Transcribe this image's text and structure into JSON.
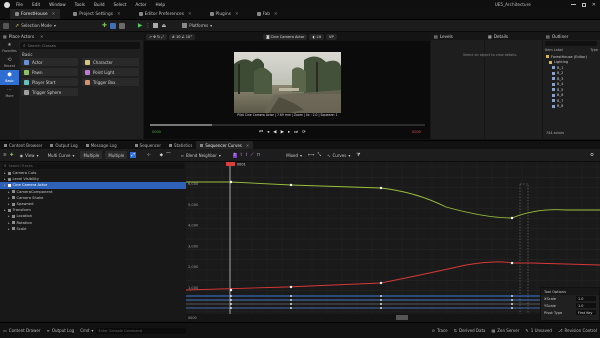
{
  "menu": [
    "File",
    "Edit",
    "Window",
    "Tools",
    "Build",
    "Select",
    "Actor",
    "Help"
  ],
  "project_name": "UE5_Architecture",
  "doc_tabs": [
    {
      "label": "ForestHouse",
      "active": true
    },
    {
      "label": "Project Settings",
      "active": false
    },
    {
      "label": "Editor Preferences",
      "active": false
    },
    {
      "label": "Plugins",
      "active": false
    },
    {
      "label": "Fab",
      "active": false
    }
  ],
  "toolbar": {
    "selection_mode": "Selection Mode",
    "platforms": "Platforms"
  },
  "place_actors": {
    "title": "Place Actors",
    "search_placeholder": "Search Classes",
    "section": "Basic",
    "categories": [
      "Favorites",
      "Recent",
      "Basic",
      "More"
    ],
    "items": [
      [
        "Actor",
        "Character"
      ],
      [
        "Pawn",
        "Point Light"
      ],
      [
        "Player Start",
        "Trigger Box"
      ],
      [
        "Trigger Sphere",
        ""
      ]
    ]
  },
  "viewport": {
    "camera_label": "Cine Camera Actor",
    "lit_label": "Lit",
    "view_label": "VP",
    "caption": "Pilot Cine Camera Actor | 7.69 mm | Zoom | 4x : 2.0 | Squeeze: 1",
    "frame_start": "0000",
    "frame_end": "0000"
  },
  "levels": {
    "title": "Levels",
    "hint": "Select an object to view details."
  },
  "details": {
    "title": "Details"
  },
  "outliner": {
    "title": "Outliner",
    "col_label": "Item Label",
    "col_type": "Type",
    "items": [
      "ForestHouse (Editor)",
      "Lighting",
      "B_1",
      "B_2",
      "B_3",
      "B_4",
      "B_5",
      "B_6",
      "B_7",
      "B_8"
    ],
    "count": "744 actors"
  },
  "bottom_tabs": [
    {
      "label": "Content Browser",
      "active": false
    },
    {
      "label": "Output Log",
      "active": false
    },
    {
      "label": "Message Log",
      "active": false
    },
    {
      "label": "Sequencer",
      "active": false
    },
    {
      "label": "Statistics",
      "active": false
    },
    {
      "label": "Sequencer Curves",
      "active": true
    }
  ],
  "curve_toolbar": {
    "view": "View",
    "multi_curve": "Multi Curve",
    "multiple": "Multiple",
    "multiple2": "Multiple",
    "blend": "Blend Neighbor",
    "mixed": "Mixed",
    "curves": "Curves",
    "frame_marker": "0001"
  },
  "tracks": {
    "search_placeholder": "Search Tracks",
    "rows": [
      {
        "label": "Camera Cuts",
        "indent": 1,
        "sel": false
      },
      {
        "label": "Level Visibility",
        "indent": 1,
        "sel": false
      },
      {
        "label": "Cine Camera Actor",
        "indent": 1,
        "sel": true
      },
      {
        "label": "CameraComponent",
        "indent": 2,
        "sel": false
      },
      {
        "label": "Camera Shake",
        "indent": 2,
        "sel": false
      },
      {
        "label": "Spawned",
        "indent": 2,
        "sel": false
      },
      {
        "label": "Transform",
        "indent": 1,
        "sel": false
      },
      {
        "label": "Location",
        "indent": 2,
        "sel": false
      },
      {
        "label": "Rotation",
        "indent": 2,
        "sel": false
      },
      {
        "label": "Scale",
        "indent": 2,
        "sel": false
      }
    ]
  },
  "graph": {
    "y_labels": [
      "6,000",
      "5,000",
      "4,000",
      "3,000",
      "2,000",
      "1,000"
    ],
    "range_start": "0000",
    "range_end": "0000"
  },
  "key_options": {
    "title": "Tool Options",
    "rows": [
      [
        "XScale",
        "1.0"
      ],
      [
        "YScale",
        "1.0"
      ],
      [
        "Pivot Type",
        "First Key"
      ]
    ]
  },
  "status": {
    "content_browser": "Content Drawer",
    "output_log": "Output Log",
    "cmd": "Cmd",
    "cmd_placeholder": "Enter Console Command",
    "trace": "Trace",
    "derived": "Derived Data",
    "zen": "Zen Server",
    "unsaved": "1 Unsaved",
    "revision": "Revision Control"
  }
}
